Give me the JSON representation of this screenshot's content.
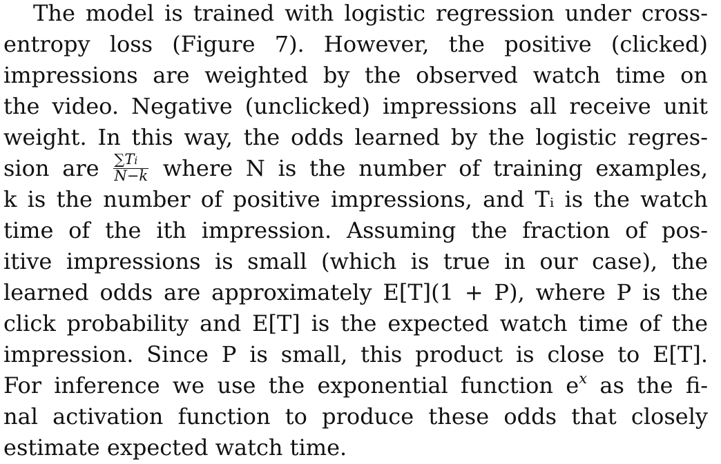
{
  "paragraph": {
    "l1": "The model is trained with logistic regression under cross-",
    "l2": "entropy loss (Figure 7).  However, the positive (clicked)",
    "l3": "impressions are weighted by the observed watch time on",
    "l4": "the video. Negative (unclicked) impressions all receive unit",
    "l5": "weight. In this way, the odds learned by the logistic regres-",
    "l6_before": "sion are",
    "frac_num": "∑T",
    "frac_num_sub": "i",
    "frac_den": "N−k",
    "l6_after": "where N is the number of training examples,",
    "l7": "k is the number of positive impressions, and Tᵢ is the watch",
    "l8": "time of the ith impression.  Assuming the fraction of pos-",
    "l9": "itive impressions is small (which is true in our case), the",
    "l10": "learned odds are approximately E[T](1 + P), where P is the",
    "l11": "click probability and E[T] is the expected watch time of the",
    "l12": "impression.  Since P is small, this product is close to E[T].",
    "l13_before": "For inference we use the exponential function e",
    "l13_sup": "x",
    "l13_after": "as the fi-",
    "l14": "nal activation function to produce these odds that closely",
    "l15": "estimate expected watch time."
  }
}
